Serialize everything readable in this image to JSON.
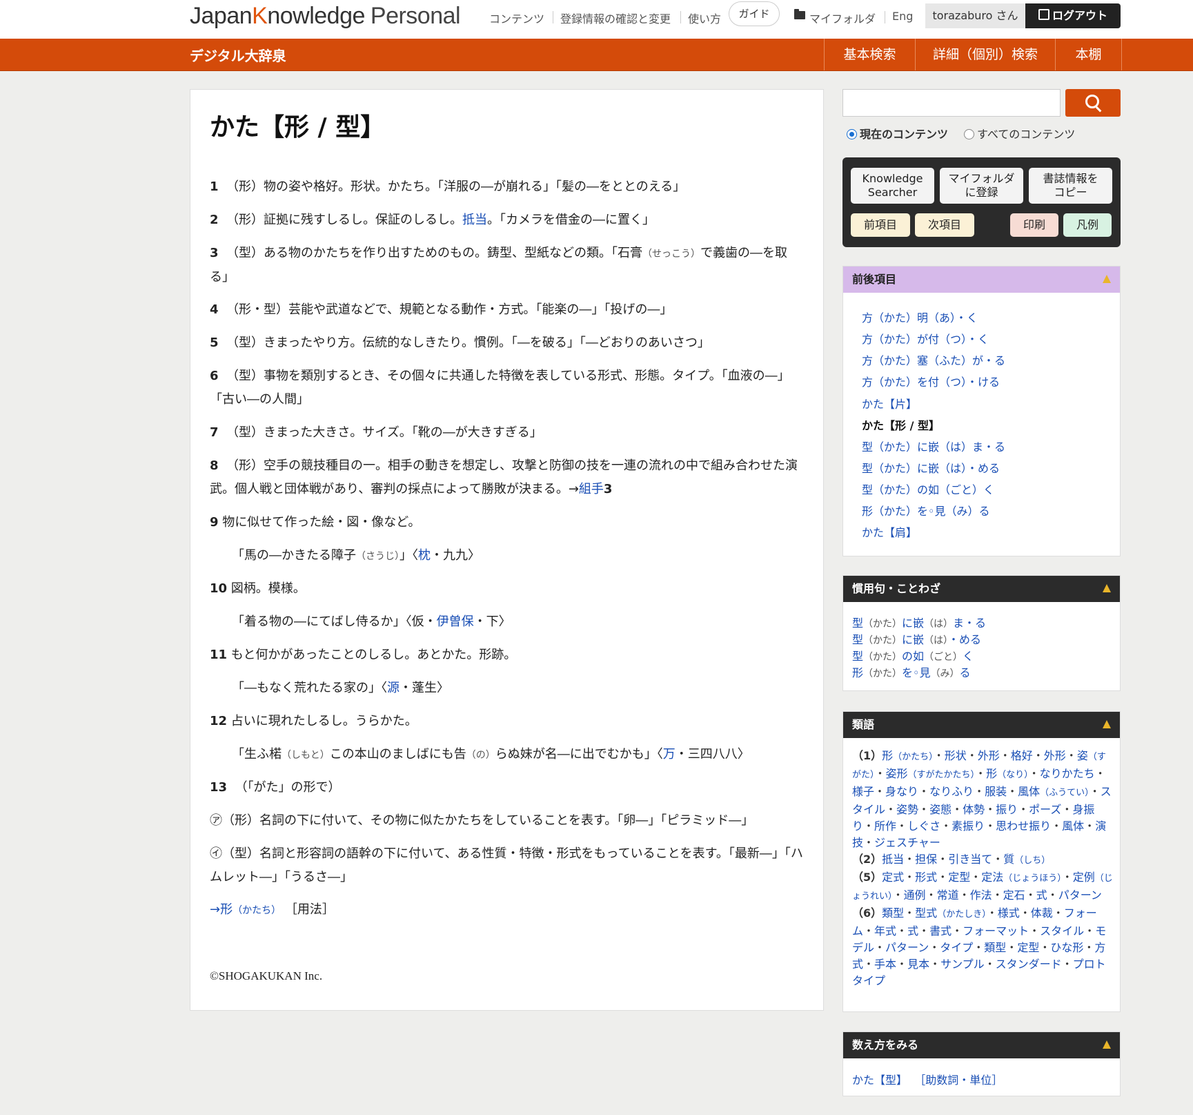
{
  "header": {
    "logo_a": "Japan",
    "logo_k": "K",
    "logo_b": "nowledge",
    "logo_personal": "Personal",
    "nav_contents": "コンテンツ",
    "nav_account": "登録情報の確認と変更",
    "nav_howto": "使い方",
    "nav_guide": "ガイド",
    "nav_myfolder": "マイフォルダ",
    "nav_eng": "Eng",
    "user": "torazaburo さん",
    "logout": "ログアウト"
  },
  "subheader": {
    "dict_title": "デジタル大辞泉",
    "tabs": [
      "基本検索",
      "詳細（個別）検索",
      "本棚"
    ]
  },
  "entry": {
    "title": "かた【形 / 型】",
    "senses": [
      {
        "num": "1",
        "body": "（形）物の姿や格好。形状。かたち。「洋服の―が崩れる」「髪の―をととのえる」"
      },
      {
        "num": "2",
        "body_a": "（形）証拠に残すしるし。保証のしるし。",
        "link": "抵当",
        "body_b": "。「カメラを借金の―に置く」"
      },
      {
        "num": "3",
        "body_a": "（型）ある物のかたちを作り出すためのもの。鋳型、型紙などの類。「石膏",
        "ruby": "（せっこう）",
        "body_b": "で義歯の―を取る」"
      },
      {
        "num": "4",
        "body": "（形・型）芸能や武道などで、規範となる動作・方式。「能楽の―」「投げの―」"
      },
      {
        "num": "5",
        "body": "（型）きまったやり方。伝統的なしきたり。慣例。「―を破る」「―どおりのあいさつ」"
      },
      {
        "num": "6",
        "body": "（型）事物を類別するとき、その個々に共通した特徴を表している形式、形態。タイプ。「血液の―」「古い―の人間」"
      },
      {
        "num": "7",
        "body": "（型）きまった大きさ。サイズ。「靴の―が大きすぎる」"
      },
      {
        "num": "8",
        "body_a": "（形）空手の競技種目の一。相手の動きを想定し、攻撃と防御の技を一連の流れの中で組み合わせた演武。個人戦と団体戦があり、審判の採点によって勝敗が決まる。→",
        "link": "組手",
        "body_b": "3"
      },
      {
        "num": "9",
        "body": "物に似せて作った絵・図・像など。"
      },
      {
        "quote_a": "「馬の―かきたる障子",
        "ruby": "（さうじ）",
        "quote_b": "」〈",
        "link": "枕",
        "quote_c": "・九九〉"
      },
      {
        "num": "10",
        "body": "図柄。模様。"
      },
      {
        "quote_a": "「着る物の―にてばし侍るか」〈仮・",
        "link": "伊曽保",
        "quote_c": "・下〉"
      },
      {
        "num": "11",
        "body": "もと何かがあったことのしるし。あとかた。形跡。"
      },
      {
        "quote_a": "「―もなく荒れたる家の」〈",
        "link": "源",
        "quote_c": "・蓬生〉"
      },
      {
        "num": "12",
        "body": "占いに現れたしるし。うらかた。"
      },
      {
        "quote_a": "「生ふ楉",
        "ruby": "（しもと）",
        "quote_b": "この本山のましばにも告",
        "ruby2": "（の）",
        "quote_b2": "らぬ妹が名―に出でむかも」〈",
        "link": "万",
        "quote_c": "・三四八八〉"
      },
      {
        "num": "13",
        "body": "（「がた」の形で）"
      },
      {
        "mark": "㋐",
        "body": "（形）名詞の下に付いて、その物に似たかたちをしていることを表す。「卵―」「ピラミッド―」"
      },
      {
        "mark": "㋑",
        "body": "（型）名詞と形容詞の語幹の下に付いて、ある性質・特徴・形式をもっていることを表す。「最新―」「ハムレット―」「うるさ―」"
      }
    ],
    "see_also_arrow": "→",
    "see_also_link": "形",
    "see_also_ruby": "（かたち）",
    "see_also_note": "［用法］",
    "copyright": "©SHOGAKUKAN Inc."
  },
  "sidebar": {
    "radio_current": "現在のコンテンツ",
    "radio_all": "すべてのコンテンツ",
    "tools": {
      "searcher": [
        "Knowledge",
        "Searcher"
      ],
      "myfolder": [
        "マイフォルダ",
        "に登録"
      ],
      "copy": [
        "書誌情報を",
        "コピー"
      ],
      "prev": "前項目",
      "next": "次項目",
      "print": "印刷",
      "legend": "凡例"
    },
    "nearby_title": "前後項目",
    "nearby": [
      "方（かた）明（あ）・く",
      "方（かた）が付（つ）・く",
      "方（かた）塞（ふた）が・る",
      "方（かた）を付（つ）・ける",
      "かた【片】",
      "かた【形 / 型】",
      "型（かた）に嵌（は）ま・る",
      "型（かた）に嵌（は）・める",
      "型（かた）の如（ごと）く",
      "形（かた）を◦見（み）る",
      "かた【肩】"
    ],
    "idioms_title": "慣用句・ことわざ",
    "idioms": [
      [
        "型",
        "（かた）",
        "に嵌",
        "（は）",
        "ま・る"
      ],
      [
        "型",
        "（かた）",
        "に嵌",
        "（は）",
        "・める"
      ],
      [
        "型",
        "（かた）",
        "の如",
        "（ごと）",
        "く"
      ],
      [
        "形",
        "（かた）",
        "を◦見",
        "（み）",
        "る"
      ]
    ],
    "synonyms_title": "類語",
    "synonyms": [
      {
        "num": "（1）",
        "items": [
          "形（かたち）",
          "形状",
          "外形",
          "格好",
          "外形",
          "姿（すがた）",
          "姿形（すがたかたち）",
          "形（なり）",
          "なりかたち",
          "様子",
          "身なり",
          "なりふり",
          "服装",
          "風体（ふうてい）",
          "スタイル",
          "姿勢",
          "姿態",
          "体勢",
          "振り",
          "ポーズ",
          "身振り",
          "所作",
          "しぐさ",
          "素振り",
          "思わせ振り",
          "風体",
          "演技",
          "ジェスチャー"
        ]
      },
      {
        "num": "（2）",
        "items": [
          "抵当",
          "担保",
          "引き当て",
          "質（しち）"
        ]
      },
      {
        "num": "（5）",
        "items": [
          "定式",
          "形式",
          "定型",
          "定法（じょうほう）",
          "定例（じょうれい）",
          "通例",
          "常道",
          "作法",
          "定石",
          "式",
          "パターン"
        ]
      },
      {
        "num": "（6）",
        "items": [
          "類型",
          "型式（かたしき）",
          "様式",
          "体裁",
          "フォーム",
          "年式",
          "式",
          "書式",
          "フォーマット",
          "スタイル",
          "モデル",
          "パターン",
          "タイプ",
          "類型",
          "定型",
          "ひな形",
          "方式",
          "手本",
          "見本",
          "サンプル",
          "スタンダード",
          "プロトタイプ"
        ]
      }
    ],
    "count_title": "数え方をみる",
    "count_link": "かた【型】",
    "count_note": "［助数詞・単位］"
  },
  "colors": {
    "accent": "#d44b0a",
    "link": "#1a4fb5",
    "dark": "#2b2b2b"
  }
}
